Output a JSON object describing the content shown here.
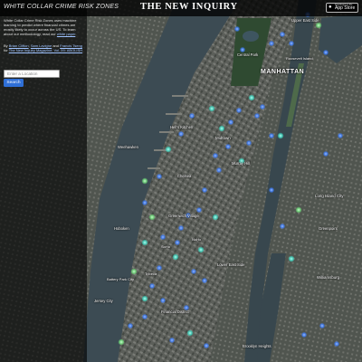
{
  "header": {
    "app_title": "WHITE COLLAR CRIME RISK ZONES",
    "brand": "THE NEW INQUIRY",
    "appstore_small": "Download on the",
    "appstore_big": "App Store"
  },
  "sidebar": {
    "description": "White Collar Crime Risk Zones uses machine learning to predict where financial crimes are mostly likely to occur across the US. To learn about our methodology, read our",
    "description_link": "white paper",
    "credits_prefix": "By",
    "author_1": "Brian Clifton",
    "author_sep_1": ",",
    "author_2": "Sam Lavigne",
    "author_sep_2": "and",
    "author_3": "Francis Tseng",
    "credits_mid": "for",
    "publication": "The New Inquiry Magazine, Vol. 59: ABOLISH",
    "location_placeholder": "Enter a Location",
    "search_label": "Search"
  },
  "map": {
    "place_labels": [
      {
        "text": "MANHATTAN"
      },
      {
        "text": "Central Park"
      },
      {
        "text": "Roosevelt Island"
      },
      {
        "text": "Hell's Kitchen"
      },
      {
        "text": "Midtown"
      },
      {
        "text": "Chelsea"
      },
      {
        "text": "Murray Hill"
      },
      {
        "text": "Greenwich Village"
      },
      {
        "text": "NoHo"
      },
      {
        "text": "SoHo"
      },
      {
        "text": "Lower East Side"
      },
      {
        "text": "Tribeca"
      },
      {
        "text": "Financial District"
      },
      {
        "text": "Battery Park City"
      },
      {
        "text": "Brooklyn Heights"
      },
      {
        "text": "Williamsburg"
      },
      {
        "text": "Long Island City"
      },
      {
        "text": "Greenpoint"
      },
      {
        "text": "Hoboken"
      },
      {
        "text": "Jersey City"
      },
      {
        "text": "Weehawken"
      },
      {
        "text": "Upper East Side"
      }
    ]
  },
  "colors": {
    "risk_high": "#3b7dff",
    "risk_mid": "#3fd6c0",
    "risk_low": "#6fe07a",
    "water": "#3a4a52",
    "land": "#565a55"
  }
}
